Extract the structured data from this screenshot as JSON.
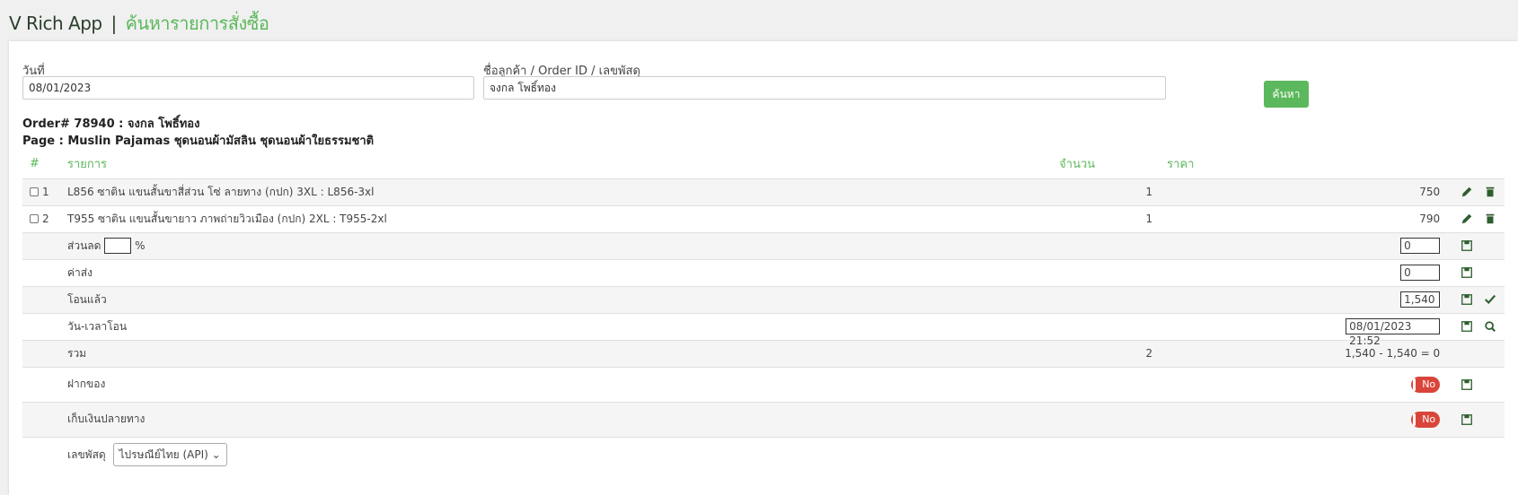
{
  "header": {
    "app_name": "V Rich App",
    "separator": "|",
    "page_name": "ค้นหารายการสั่งซื้อ"
  },
  "search": {
    "date_label": "วันที่",
    "date_value": "08/01/2023",
    "query_label": "ชื่อลูกค้า / Order ID / เลขพัสดุ",
    "query_value": "จงกล โพธิ์ทอง",
    "button_label": "ค้นหา"
  },
  "order": {
    "title": "Order# 78940 : จงกล โพธิ์ทอง",
    "page": "Page : Muslin Pajamas ชุดนอนผ้ามัสลิน ชุดนอนผ้าใยธรรมชาติ"
  },
  "table": {
    "headers": {
      "idx": "#",
      "item": "รายการ",
      "qty": "จำนวน",
      "price": "ราคา"
    },
    "items": [
      {
        "no": "1",
        "name": "L856 ซาติน แขนสั้นขาสี่ส่วน โซ่ ลายทาง (กปก) 3XL : L856-3xl",
        "qty": "1",
        "price": "750"
      },
      {
        "no": "2",
        "name": "T955 ซาติน แขนสั้นขายาว ภาพถ่ายวิวเมือง (กปก) 2XL : T955-2xl",
        "qty": "1",
        "price": "790"
      }
    ],
    "discount": {
      "label": "ส่วนลด",
      "value": "",
      "unit": "%",
      "amount": "0"
    },
    "shipping": {
      "label": "ค่าส่ง",
      "value": "0"
    },
    "paid": {
      "label": "โอนแล้ว",
      "value": "1,540"
    },
    "paid_time": {
      "label": "วัน-เวลาโอน",
      "value": "08/01/2023 21:52"
    },
    "total": {
      "label": "รวม",
      "qty": "2",
      "summary": "1,540 - 1,540 = 0"
    },
    "deposit": {
      "label": "ฝากของ",
      "toggle": "No"
    },
    "cod": {
      "label": "เก็บเงินปลายทาง",
      "toggle": "No"
    },
    "tracking": {
      "label": "เลขพัสดุ",
      "carrier": "ไปรษณีย์ไทย (API)"
    }
  }
}
